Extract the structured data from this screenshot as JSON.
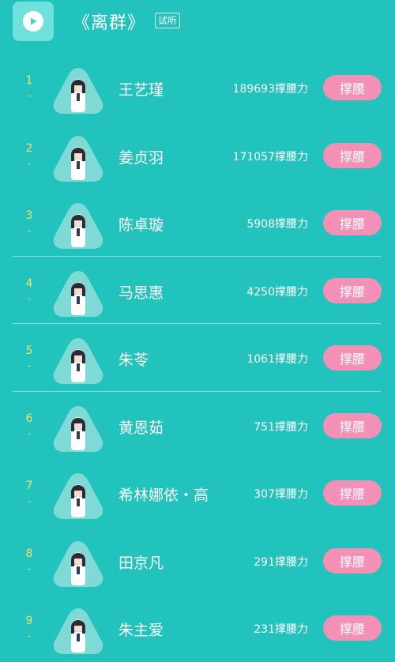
{
  "header": {
    "song_title": "《离群》",
    "try_label": "试听",
    "play_icon": "play-icon"
  },
  "colors": {
    "background": "#22c2bd",
    "rank": "#f3e45c",
    "button": "#f48fb6"
  },
  "rows": [
    {
      "rank": "1",
      "dash": "-",
      "name": "王艺瑾",
      "power": "189693撑腰力",
      "button": "撑腰"
    },
    {
      "rank": "2",
      "dash": "-",
      "name": "姜贞羽",
      "power": "171057撑腰力",
      "button": "撑腰"
    },
    {
      "rank": "3",
      "dash": "-",
      "name": "陈卓璇",
      "power": "5908撑腰力",
      "button": "撑腰"
    },
    {
      "rank": "4",
      "dash": "-",
      "name": "马思惠",
      "power": "4250撑腰力",
      "button": "撑腰"
    },
    {
      "rank": "5",
      "dash": "-",
      "name": "朱苓",
      "power": "1061撑腰力",
      "button": "撑腰"
    },
    {
      "rank": "6",
      "dash": "-",
      "name": "黄恩茹",
      "power": "751撑腰力",
      "button": "撑腰"
    },
    {
      "rank": "7",
      "dash": "-",
      "name": "希林娜依・高",
      "power": "307撑腰力",
      "button": "撑腰"
    },
    {
      "rank": "8",
      "dash": "-",
      "name": "田京凡",
      "power": "291撑腰力",
      "button": "撑腰"
    },
    {
      "rank": "9",
      "dash": "-",
      "name": "朱主爱",
      "power": "231撑腰力",
      "button": "撑腰"
    }
  ]
}
